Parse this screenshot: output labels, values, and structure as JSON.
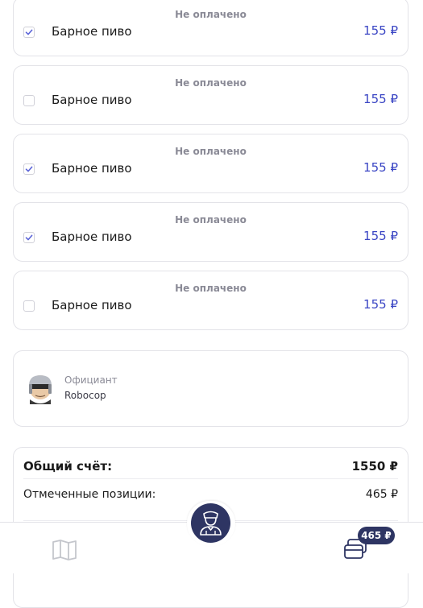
{
  "order": {
    "items": [
      {
        "status": "Не оплачено",
        "name": "Барное пиво",
        "price": "155 ₽",
        "checked": true
      },
      {
        "status": "Не оплачено",
        "name": "Барное пиво",
        "price": "155 ₽",
        "checked": false
      },
      {
        "status": "Не оплачено",
        "name": "Барное пиво",
        "price": "155 ₽",
        "checked": true
      },
      {
        "status": "Не оплачено",
        "name": "Барное пиво",
        "price": "155 ₽",
        "checked": true
      },
      {
        "status": "Не оплачено",
        "name": "Барное пиво",
        "price": "155 ₽",
        "checked": false
      }
    ]
  },
  "waiter": {
    "role": "Официант",
    "name": "Robocop",
    "avatar_icon": "robocop-avatar-icon"
  },
  "summary": {
    "total_label": "Общий счёт:",
    "total_value": "1550 ₽",
    "marked_label": "Отмеченные позиции:",
    "marked_value": "465 ₽"
  },
  "nav": {
    "menu_icon": "book-icon",
    "call_waiter_icon": "waiter-icon",
    "bill_icon": "cards-icon",
    "badge": "465 ₽"
  },
  "colors": {
    "accent": "#3b46c4",
    "dark": "#2e3563",
    "check": "#5a63d8",
    "muted": "#8a8a96"
  }
}
